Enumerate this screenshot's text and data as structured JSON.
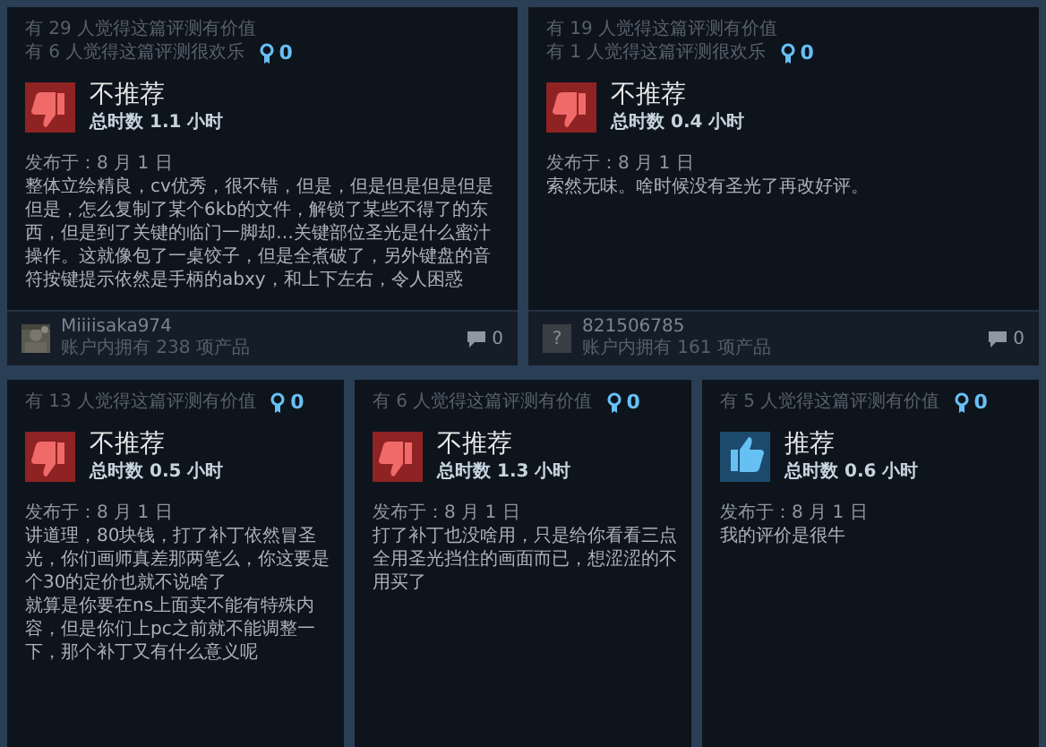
{
  "rows": [
    {
      "reviews": [
        {
          "helpful": "有 29 人觉得这篇评测有价值",
          "funny": "有 6 人觉得这篇评测很欢乐",
          "awards": "0",
          "recommended": false,
          "verdict": "不推荐",
          "hours": "总时数 1.1 小时",
          "posted": "发布于：8 月 1 日",
          "body": [
            "整体立绘精良，cv优秀，很不错，但是，但是但是但是但是但是，怎么复制了某个6kb的文件，解锁了某些不得了的东西，但是到了关键的临门一脚却…关键部位圣光是什么蜜汁操作。这就像包了一桌饺子，但是全煮破了，另外键盘的音符按键提示依然是手柄的abxy，和上下左右，令人困惑"
          ],
          "author": {
            "name": "Miiiisaka974",
            "products": "账户内拥有 238 项产品"
          },
          "comments": "0"
        },
        {
          "helpful": "有 19 人觉得这篇评测有价值",
          "funny": "有 1 人觉得这篇评测很欢乐",
          "awards": "0",
          "recommended": false,
          "verdict": "不推荐",
          "hours": "总时数 0.4 小时",
          "posted": "发布于：8 月 1 日",
          "body": [
            "索然无味。啥时候没有圣光了再改好评。"
          ],
          "author": {
            "name": "821506785",
            "products": "账户内拥有 161 项产品",
            "avatar": {
              "kind": "placeholder",
              "text": "?"
            }
          },
          "comments": "0"
        }
      ]
    },
    {
      "reviews": [
        {
          "helpful": "有 13 人觉得这篇评测有价值",
          "awards": "0",
          "recommended": false,
          "verdict": "不推荐",
          "hours": "总时数 0.5 小时",
          "posted": "发布于：8 月 1 日",
          "body": [
            "讲道理，80块钱，打了补丁依然冒圣光，你们画师真差那两笔么，你这要是个30的定价也就不说啥了",
            "就算是你要在ns上面卖不能有特殊内容，但是你们上pc之前就不能调整一下，那个补丁又有什么意义呢"
          ]
        },
        {
          "helpful": "有 6 人觉得这篇评测有价值",
          "awards": "0",
          "recommended": false,
          "verdict": "不推荐",
          "hours": "总时数 1.3 小时",
          "posted": "发布于：8 月 1 日",
          "body": [
            "打了补丁也没啥用，只是给你看看三点全用圣光挡住的画面而已，想涩涩的不用买了"
          ]
        },
        {
          "helpful": "有 5 人觉得这篇评测有价值",
          "awards": "0",
          "recommended": true,
          "verdict": "推荐",
          "hours": "总时数 0.6 小时",
          "posted": "发布于：8 月 1 日",
          "body": [
            "我的评价是很牛"
          ]
        }
      ]
    }
  ]
}
